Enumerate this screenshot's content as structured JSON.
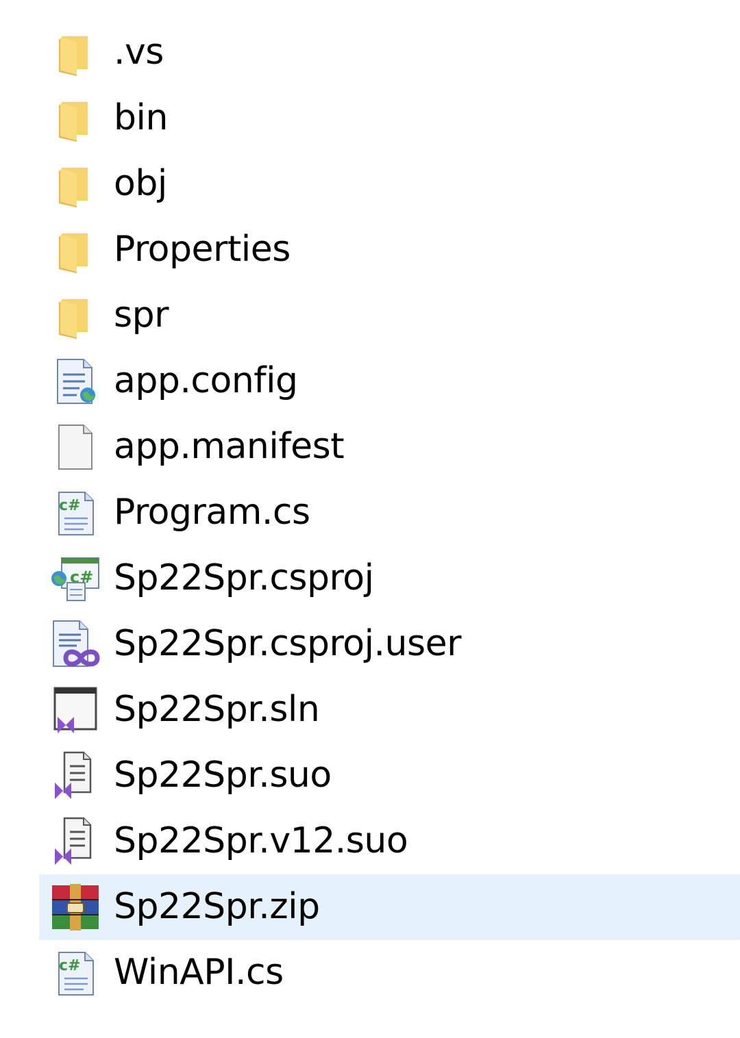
{
  "explorer": {
    "selected_index": 13,
    "colors": {
      "selection": "#e5f1fb",
      "folder": "#f6d36c",
      "text": "#000000"
    },
    "items": [
      {
        "name": ".vs",
        "icon": "folder-icon"
      },
      {
        "name": "bin",
        "icon": "folder-icon"
      },
      {
        "name": "obj",
        "icon": "folder-icon"
      },
      {
        "name": "Properties",
        "icon": "folder-icon"
      },
      {
        "name": "spr",
        "icon": "folder-icon"
      },
      {
        "name": "app.config",
        "icon": "config-file-icon"
      },
      {
        "name": "app.manifest",
        "icon": "blank-file-icon"
      },
      {
        "name": "Program.cs",
        "icon": "csharp-file-icon"
      },
      {
        "name": "Sp22Spr.csproj",
        "icon": "csharp-project-icon"
      },
      {
        "name": "Sp22Spr.csproj.user",
        "icon": "vs-user-file-icon"
      },
      {
        "name": "Sp22Spr.sln",
        "icon": "vs-solution-icon"
      },
      {
        "name": "Sp22Spr.suo",
        "icon": "vs-suo-file-icon"
      },
      {
        "name": "Sp22Spr.v12.suo",
        "icon": "vs-suo-file-icon"
      },
      {
        "name": "Sp22Spr.zip",
        "icon": "winrar-archive-icon"
      },
      {
        "name": "WinAPI.cs",
        "icon": "csharp-file-icon"
      }
    ]
  }
}
